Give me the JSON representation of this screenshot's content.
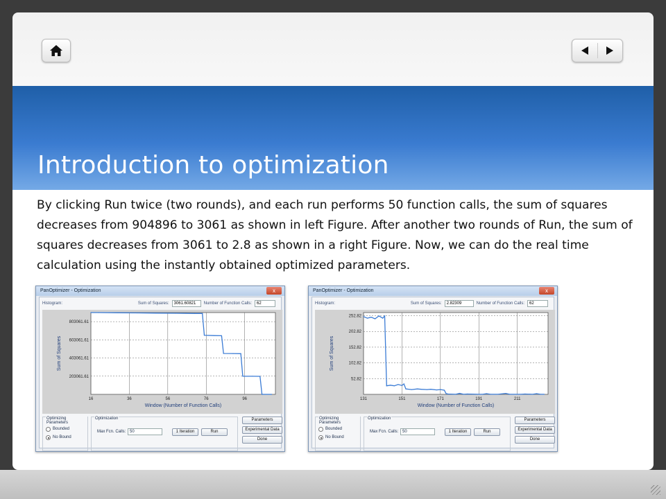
{
  "slide": {
    "title": "Introduction to optimization",
    "body": "By clicking Run twice (two rounds), and each run performs 50 function calls, the sum of squares decreases from 904896 to 3061 as shown in left Figure. After another two rounds of Run, the sum of squares decreases from 3061 to 2.8 as shown in a right Figure. Now, we can do the real time calculation using the instantly obtained optimized parameters."
  },
  "nav": {
    "home_icon": "home-icon",
    "prev_icon": "triangle-left-icon",
    "next_icon": "triangle-right-icon"
  },
  "windows": [
    {
      "title": "PanOptimizer - Optimization",
      "close": "x",
      "histogram_label": "Histogram:",
      "sum_label": "Sum of Squares:",
      "sum_value": "3061.60821",
      "calls_label": "Number of Function Calls:",
      "calls_value": "62",
      "ylabel": "Sum of Squares",
      "xlabel": "Window (Number of Function Calls)",
      "yticks": [
        "803061.61",
        "603061.61",
        "403061.61",
        "203061.61"
      ],
      "xticks": [
        "16",
        "36",
        "56",
        "76",
        "96"
      ],
      "group1": "Optimizing Parameters",
      "opt_bounded": "Bounded",
      "opt_nobound": "No Bound",
      "group2": "Optimization",
      "maxcalls_label": "Max Fcn. Calls:",
      "maxcalls_value": "50",
      "iter_btn": "1 Iteration",
      "run_btn": "Run",
      "params_btn": "Parameters",
      "exp_btn": "Experimental Data",
      "done_btn": "Done"
    },
    {
      "title": "PanOptimizer - Optimization",
      "close": "x",
      "histogram_label": "Histogram:",
      "sum_label": "Sum of Squares:",
      "sum_value": "2.82309",
      "calls_label": "Number of Function Calls:",
      "calls_value": "62",
      "ylabel": "Sum of Squares",
      "xlabel": "Window (Number of Function Calls)",
      "yticks": [
        "252.82",
        "202.82",
        "152.82",
        "102.82",
        "52.82"
      ],
      "xticks": [
        "131",
        "151",
        "171",
        "191",
        "211"
      ],
      "group1": "Optimizing Parameters",
      "opt_bounded": "Bounded",
      "opt_nobound": "No Bound",
      "group2": "Optimization",
      "maxcalls_label": "Max Fcn. Calls:",
      "maxcalls_value": "50",
      "iter_btn": "1 Iteration",
      "run_btn": "Run",
      "params_btn": "Parameters",
      "exp_btn": "Experimental Data",
      "done_btn": "Done"
    }
  ],
  "chart_data": [
    {
      "type": "line",
      "ylabel": "Sum of Squares",
      "xlabel": "Window (Number of Function Calls)",
      "xlim": [
        16,
        112
      ],
      "ylim": [
        3061.61,
        903061.61
      ],
      "x": [
        16,
        20,
        30,
        40,
        50,
        60,
        70,
        74,
        75,
        80,
        84,
        85,
        90,
        94,
        95,
        100,
        104,
        105,
        110
      ],
      "y": [
        903061.61,
        903061.61,
        901061.61,
        899061.61,
        897061.61,
        895061.61,
        893061.61,
        893061.61,
        653061.61,
        650061.61,
        648061.61,
        453061.61,
        452061.61,
        451061.61,
        203061.61,
        202061.61,
        201061.61,
        3061.61,
        3061.61
      ],
      "color": "#3a7bd5"
    },
    {
      "type": "line",
      "ylabel": "Sum of Squares",
      "xlabel": "Window (Number of Function Calls)",
      "xlim": [
        131,
        227
      ],
      "ylim": [
        2.82,
        262.82
      ],
      "x": [
        131,
        133,
        135,
        137,
        139,
        141,
        142,
        143,
        145,
        147,
        149,
        151,
        152,
        153,
        156,
        159,
        161,
        164,
        166,
        169,
        171,
        173,
        174,
        175,
        179,
        181,
        183,
        185,
        191,
        193,
        195,
        197,
        201,
        205,
        207,
        211,
        213,
        215,
        219,
        221,
        223,
        225
      ],
      "y": [
        250,
        245,
        248,
        243,
        252,
        245,
        252,
        30,
        32,
        30,
        34,
        31,
        36,
        20,
        18,
        20,
        19,
        18,
        19,
        17,
        18,
        16,
        5,
        4,
        3,
        6,
        3,
        4,
        3,
        3,
        5,
        3,
        3,
        6,
        3,
        3,
        3,
        4,
        3,
        5,
        3,
        3
      ],
      "color": "#3a7bd5"
    }
  ]
}
